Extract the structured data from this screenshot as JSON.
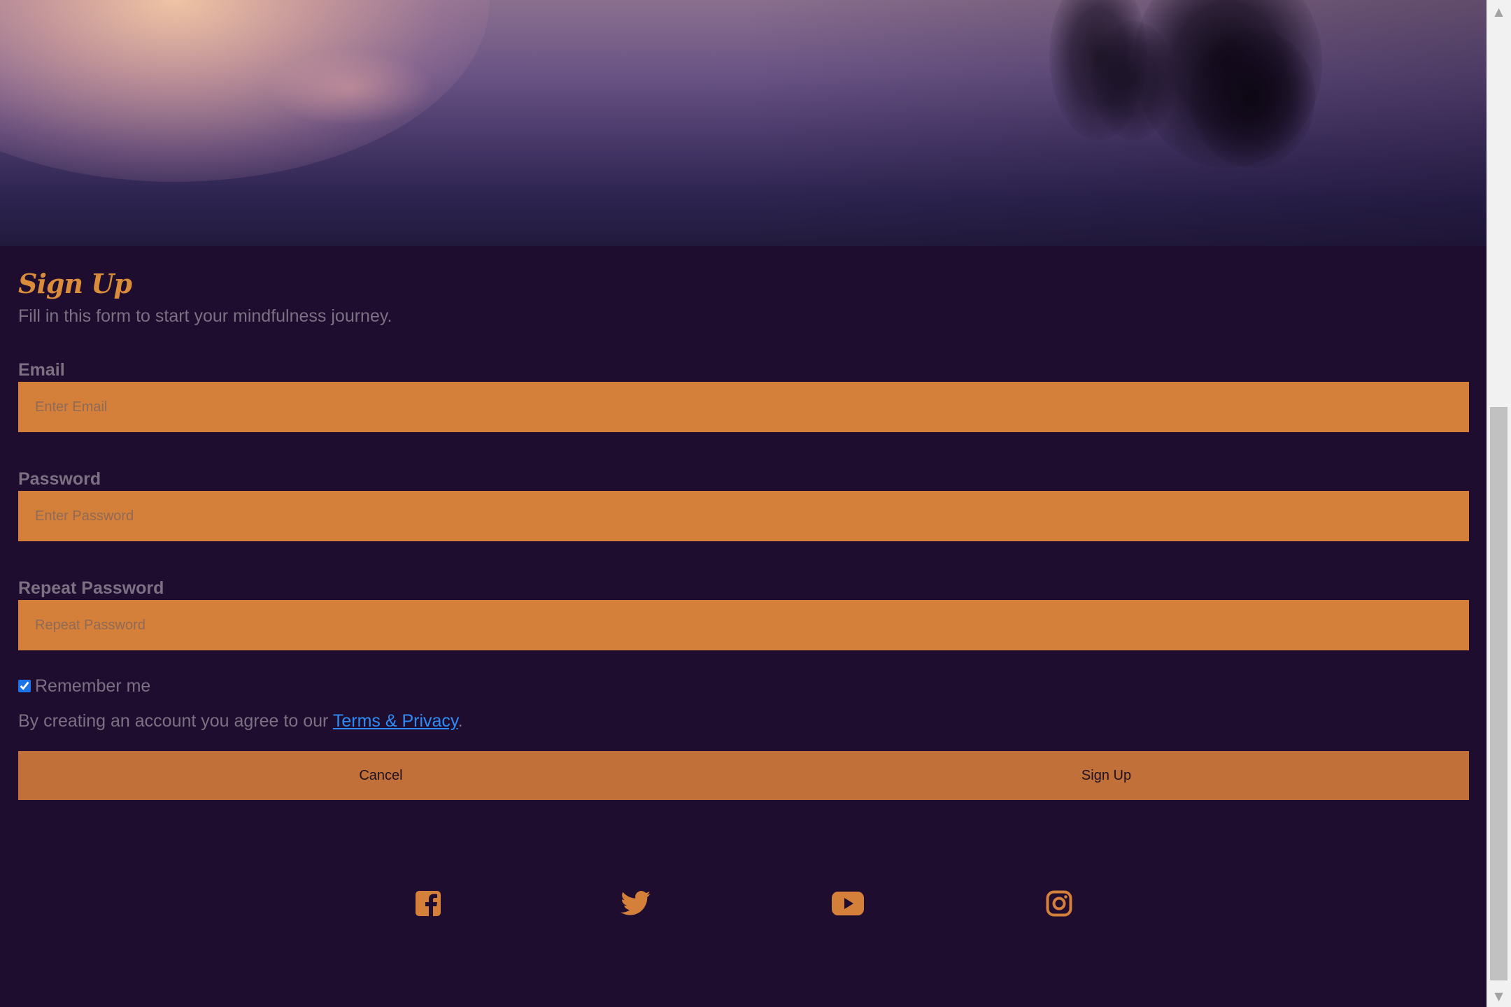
{
  "form": {
    "title": "Sign Up",
    "subtitle": "Fill in this form to start your mindfulness journey.",
    "email_label": "Email",
    "email_placeholder": "Enter Email",
    "password_label": "Password",
    "password_placeholder": "Enter Password",
    "repeat_label": "Repeat Password",
    "repeat_placeholder": "Repeat Password",
    "remember_label": "Remember me",
    "remember_checked": true,
    "terms_prefix": "By creating an account you agree to our ",
    "terms_link": "Terms & Privacy",
    "terms_suffix": ".",
    "cancel_label": "Cancel",
    "signup_label": "Sign Up"
  },
  "social": {
    "icons": [
      "facebook-icon",
      "twitter-icon",
      "youtube-icon",
      "instagram-icon"
    ]
  },
  "colors": {
    "background": "#1e0d2f",
    "accent": "#d5803a",
    "button": "#c1703a",
    "title": "#d98c3a",
    "link": "#2f8cf5",
    "muted_text": "#7c7082"
  }
}
